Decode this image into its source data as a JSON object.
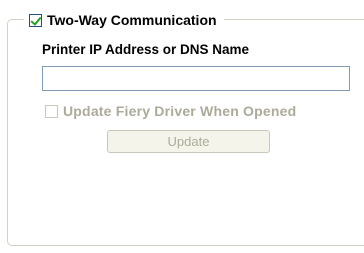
{
  "group": {
    "title": "Two-Way Communication",
    "checked": true
  },
  "printer_field": {
    "label": "Printer IP Address or DNS Name",
    "value": "",
    "placeholder": ""
  },
  "update_option": {
    "label": "Update Fiery Driver When Opened",
    "checked": false,
    "enabled": false
  },
  "update_button": {
    "label": "Update",
    "enabled": false
  },
  "colors": {
    "check_mark": "#21a121",
    "disabled_text": "#acaa99",
    "input_border": "#7f9db9",
    "group_border": "#d3d0c4"
  }
}
